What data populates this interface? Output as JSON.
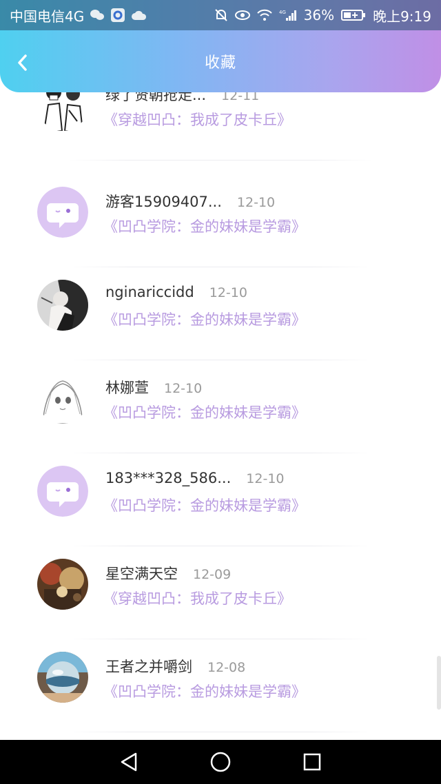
{
  "status_bar": {
    "carrier": "中国电信4G",
    "battery_percent": "36%",
    "time": "晚上9:19",
    "network_label": "4G"
  },
  "header": {
    "title": "收藏"
  },
  "items": [
    {
      "name": "绿了贤朝抢走...",
      "date": "12-11",
      "book": "《穿越凹凸：我成了皮卡丘》",
      "avatar": "sketch-couple-avatar"
    },
    {
      "name": "游客15909407...",
      "date": "12-10",
      "book": "《凹凸学院：金的妹妹是学霸》",
      "avatar": "default-chat-avatar"
    },
    {
      "name": "nginariccidd",
      "date": "12-10",
      "book": "《凹凸学院：金的妹妹是学霸》",
      "avatar": "photo-girl-avatar"
    },
    {
      "name": "林娜萱",
      "date": "12-10",
      "book": "《凹凸学院：金的妹妹是学霸》",
      "avatar": "anime-girl-avatar"
    },
    {
      "name": "183***328_586...",
      "date": "12-10",
      "book": "《凹凸学院：金的妹妹是学霸》",
      "avatar": "default-chat-avatar"
    },
    {
      "name": "星空满天空",
      "date": "12-09",
      "book": "《穿越凹凸：我成了皮卡丘》",
      "avatar": "painted-scene-avatar"
    },
    {
      "name": "王者之并嚼剑",
      "date": "12-08",
      "book": "《凹凸学院：金的妹妹是学霸》",
      "avatar": "glass-sphere-avatar"
    }
  ],
  "colors": {
    "accent_purple": "#b89be0",
    "gradient_start": "#4fd0f0",
    "gradient_end": "#c08fe6"
  }
}
